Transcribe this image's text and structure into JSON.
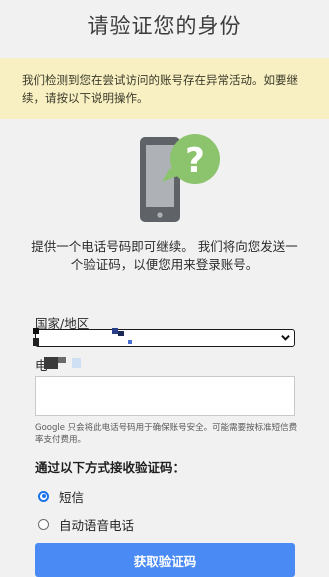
{
  "page": {
    "title": "请验证您的身份"
  },
  "warning": {
    "text": "我们检测到您在尝试访问的账号存在异常活动。如要继续，请按以下说明操作。"
  },
  "illustration": {
    "icon": "phone-question-icon",
    "symbol": "?",
    "colors": {
      "phone": "#5f6368",
      "screen": "#aeb2b6",
      "bubble": "#8cc46d"
    }
  },
  "instructions": {
    "text": "提供一个电话号码即可继续。 我们将向您发送一个验证码，以便您用来登录账号。"
  },
  "form": {
    "country_label": "国家/地区",
    "phone_label_fragment": "电",
    "phone_value": "",
    "note": "Google 只会将此电话号码用于确保账号安全。可能需要按标准短信费率支付费用。"
  },
  "methods": {
    "heading": "通过以下方式接收验证码：",
    "options": [
      {
        "label": "短信",
        "checked": true
      },
      {
        "label": "自动语音电话",
        "checked": false
      }
    ]
  },
  "submit": {
    "label": "获取验证码"
  },
  "colors": {
    "accent": "#1a73e8",
    "button": "#4a8af4",
    "warning_bg": "#f8f0c2",
    "page_bg": "#f1f1f1"
  }
}
